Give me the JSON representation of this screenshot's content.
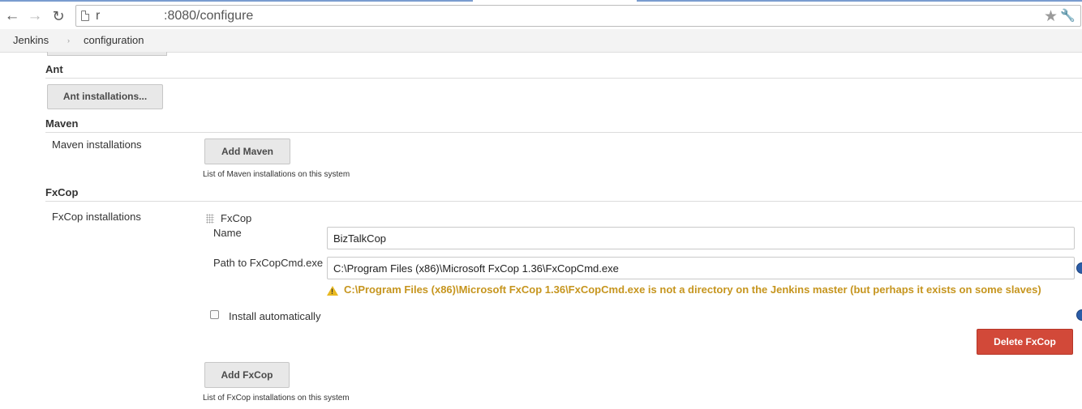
{
  "browser": {
    "url_host": "r",
    "url_path": ":8080/configure",
    "icons": {
      "back": "back-arrow-icon",
      "forward": "forward-arrow-icon",
      "reload": "reload-icon",
      "page": "page-icon",
      "bookmark": "star-icon",
      "settings": "wrench-icon"
    }
  },
  "breadcrumb": {
    "items": [
      "Jenkins",
      "configuration"
    ],
    "separator": "›"
  },
  "sections": {
    "ant": {
      "title": "Ant",
      "button_label": "Ant installations..."
    },
    "maven": {
      "title": "Maven",
      "field_label": "Maven installations",
      "button_label": "Add Maven",
      "help_text": "List of Maven installations on this system"
    },
    "fxcop": {
      "title": "FxCop",
      "field_label": "FxCop installations",
      "installation_header": "FxCop",
      "name_label": "Name",
      "name_value": "BizTalkCop",
      "path_label": "Path to FxCopCmd.exe",
      "path_value": "C:\\Program Files (x86)\\Microsoft FxCop 1.36\\FxCopCmd.exe",
      "warning_text": "C:\\Program Files (x86)\\Microsoft FxCop 1.36\\FxCopCmd.exe is not a directory on the Jenkins master (but perhaps it exists on some slaves)",
      "install_automatically_label": "Install automatically",
      "install_automatically_checked": false,
      "delete_button_label": "Delete FxCop",
      "add_button_label": "Add FxCop",
      "help_text": "List of FxCop installations on this system"
    }
  },
  "colors": {
    "warning": "#c6951e",
    "danger_button": "#d24939",
    "help_icon": "#2b5da8"
  }
}
